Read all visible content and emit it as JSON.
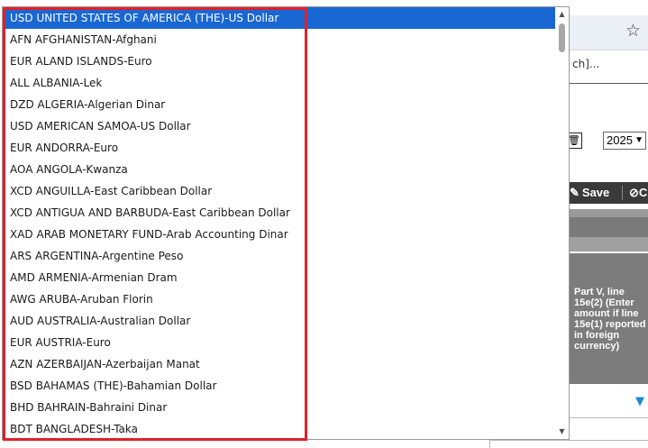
{
  "background": {
    "search_hint": "ch]...",
    "year_select": "2025",
    "save_label": "Save",
    "cancel_fragment": "C",
    "column_header": "Part V, line 15e(2) (Enter amount if line 15e(1) reported in foreign currency)"
  },
  "dropdown": {
    "selected_index": 0,
    "options": [
      "USD UNITED STATES OF AMERICA (THE)-US Dollar",
      "AFN AFGHANISTAN-Afghani",
      "EUR ALAND ISLANDS-Euro",
      "ALL ALBANIA-Lek",
      "DZD ALGERIA-Algerian Dinar",
      "USD AMERICAN SAMOA-US Dollar",
      "EUR ANDORRA-Euro",
      "AOA ANGOLA-Kwanza",
      "XCD ANGUILLA-East Caribbean Dollar",
      "XCD ANTIGUA AND BARBUDA-East Caribbean Dollar",
      "XAD ARAB MONETARY FUND-Arab Accounting Dinar",
      "ARS ARGENTINA-Argentine Peso",
      "AMD ARMENIA-Armenian Dram",
      "AWG ARUBA-Aruban Florin",
      "AUD AUSTRALIA-Australian Dollar",
      "EUR AUSTRIA-Euro",
      "AZN AZERBAIJAN-Azerbaijan Manat",
      "BSD BAHAMAS (THE)-Bahamian Dollar",
      "BHD BAHRAIN-Bahraini Dinar",
      "BDT BANGLADESH-Taka"
    ]
  },
  "colors": {
    "selected_bg": "#1967d2",
    "highlight_border": "#e2202a"
  },
  "icons": {
    "star": "star-icon",
    "trash": "trash-icon",
    "save": "edit-icon",
    "cancel": "cancel-icon",
    "filter": "filter-icon"
  }
}
